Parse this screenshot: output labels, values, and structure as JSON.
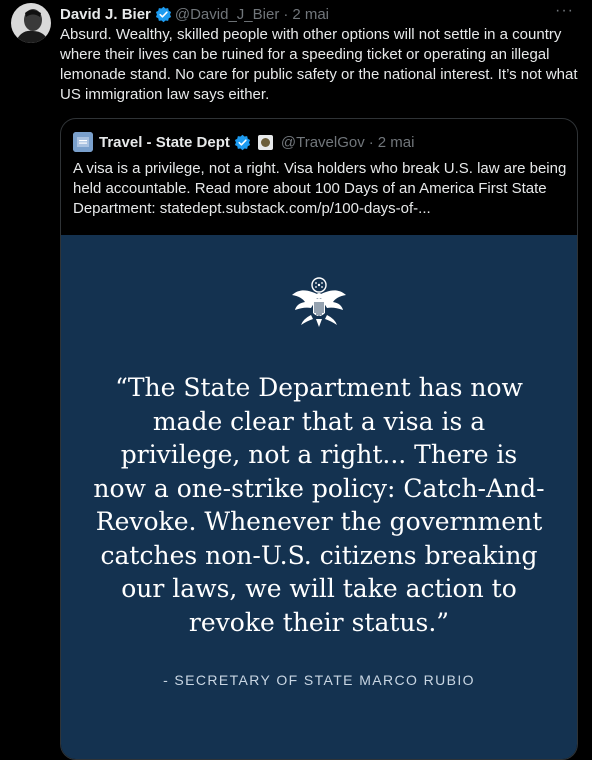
{
  "author": {
    "name": "David J. Bier",
    "handle": "@David_J_Bier",
    "separator": "·",
    "time": "2 mai",
    "more": "···"
  },
  "tweet": {
    "text": "Absurd. Wealthy, skilled people with other options will not settle in a country where their lives can be ruined for a speeding ticket or operating an illegal lemonade stand. No care for public safety or the national interest. It’s not what US immigration law says either."
  },
  "quoted": {
    "name": "Travel - State Dept",
    "handle": "@TravelGov",
    "separator": "·",
    "time": "2 mai",
    "text": "A visa is a privilege, not a right. Visa holders who break U.S. law are being held accountable. Read more about 100 Days of an America First State Department: statedept.substack.com/p/100-days-of-..."
  },
  "card": {
    "quote": "“The State Department has now made clear that a visa is a privilege, not a right... There is now a one-strike policy: Catch-And-Revoke. Whenever the government catches non-U.S. citizens breaking our laws, we will take action to revoke their status.”",
    "attribution": "- SECRETARY OF STATE MARCO RUBIO"
  },
  "icons": {
    "verified": "verified-badge-icon",
    "affiliate": "state-seal-affiliate-icon",
    "seal": "great-seal-eagle-icon"
  },
  "colors": {
    "background": "#000000",
    "card": "#143250",
    "verified": "#1d9bf0",
    "muted": "#71767b"
  }
}
